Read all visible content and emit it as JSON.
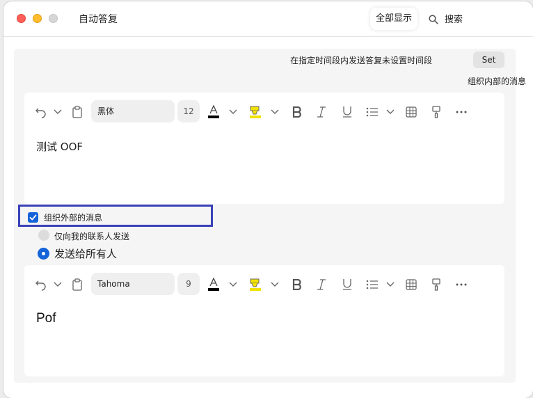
{
  "window": {
    "title": "自动答复",
    "show_all": "全部显示",
    "search_label": "搜索"
  },
  "schedule": {
    "text": "在指定时间段内发送答复未设置时间段",
    "set_label": "Set"
  },
  "internal": {
    "label": "组织内部的消息"
  },
  "editor_internal": {
    "font": "黑体",
    "size": "12",
    "body": "测试 OOF"
  },
  "external": {
    "checkbox_label": "组织外部的消息",
    "checked": true,
    "radio_contacts": "仅向我的联系人发送",
    "radio_all": "发送给所有人",
    "selected": "all"
  },
  "editor_external": {
    "font": "Tahoma",
    "size": "9",
    "body": "Pof"
  },
  "colors": {
    "accent": "#1463d8",
    "highlight_box": "#3a41b8",
    "text_color_swatch": "#000000",
    "highlight_swatch": "#f2e200"
  },
  "icons": [
    "undo-icon",
    "chevron-down-icon",
    "clipboard-icon",
    "font-color-icon",
    "highlighter-icon",
    "bold-icon",
    "italic-icon",
    "underline-icon",
    "bullet-list-icon",
    "table-icon",
    "format-painter-icon",
    "more-icon",
    "search-icon"
  ]
}
